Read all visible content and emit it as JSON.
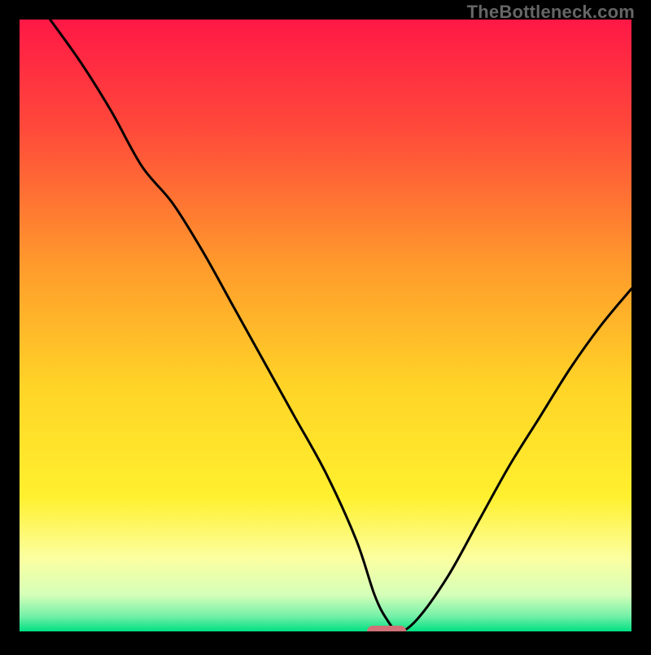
{
  "watermark": "TheBottleneck.com",
  "chart_data": {
    "type": "line",
    "title": "",
    "xlabel": "",
    "ylabel": "",
    "xlim": [
      0,
      100
    ],
    "ylim": [
      0,
      100
    ],
    "grid": false,
    "series": [
      {
        "name": "bottleneck-curve",
        "x": [
          5,
          10,
          15,
          20,
          25,
          30,
          35,
          40,
          45,
          50,
          55,
          58,
          60,
          62,
          65,
          70,
          75,
          80,
          85,
          90,
          95,
          100
        ],
        "y": [
          100,
          93,
          85,
          76,
          70,
          62,
          53,
          44,
          35,
          26,
          15,
          6,
          2,
          0,
          2,
          9,
          18,
          27,
          35,
          43,
          50,
          56
        ]
      }
    ],
    "marker": {
      "name": "optimal-band",
      "x_center": 60,
      "x_halfwidth": 3.2,
      "y": 0,
      "color": "#d07077"
    },
    "background_gradient": {
      "stops": [
        {
          "offset": 0.0,
          "color": "#ff1846"
        },
        {
          "offset": 0.18,
          "color": "#ff4a3a"
        },
        {
          "offset": 0.4,
          "color": "#ff9a2c"
        },
        {
          "offset": 0.6,
          "color": "#ffd427"
        },
        {
          "offset": 0.78,
          "color": "#fff02e"
        },
        {
          "offset": 0.88,
          "color": "#fcffa0"
        },
        {
          "offset": 0.94,
          "color": "#d5ffb9"
        },
        {
          "offset": 0.975,
          "color": "#74f0a8"
        },
        {
          "offset": 1.0,
          "color": "#00e082"
        }
      ]
    },
    "frame": {
      "border_color": "#000000",
      "border_width": 24
    }
  }
}
